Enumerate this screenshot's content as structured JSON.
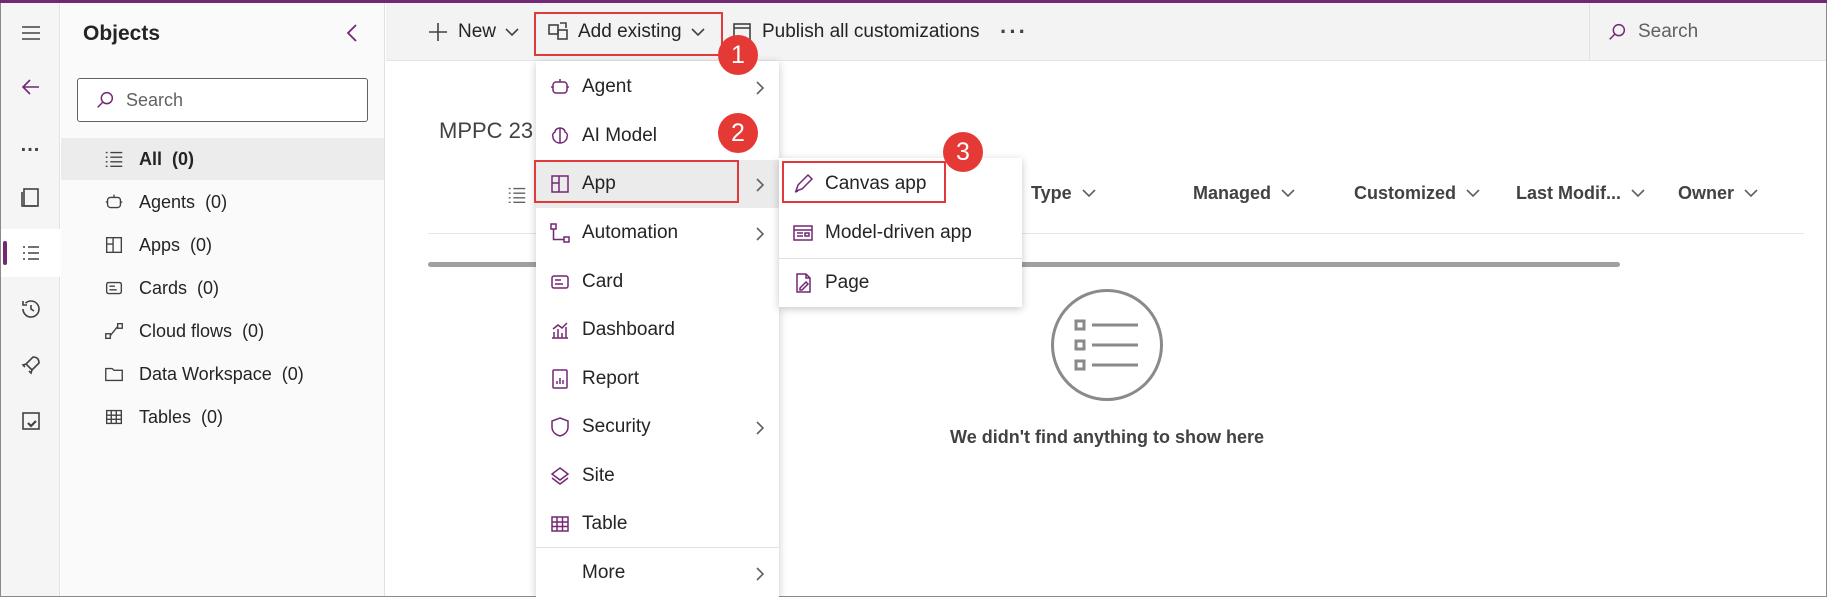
{
  "rail": {
    "items": [
      {
        "name": "menu-icon"
      },
      {
        "name": "back-arrow-icon"
      },
      {
        "name": "more-icon",
        "label": "..."
      },
      {
        "name": "pages-icon"
      },
      {
        "name": "objects-icon"
      },
      {
        "name": "history-icon"
      },
      {
        "name": "rocket-icon"
      },
      {
        "name": "solution-checker-icon"
      }
    ]
  },
  "objects_panel": {
    "title": "Objects",
    "search_placeholder": "Search",
    "items": [
      {
        "label": "All",
        "count": "(0)",
        "icon": "list-icon"
      },
      {
        "label": "Agents",
        "count": "(0)",
        "icon": "bot-icon"
      },
      {
        "label": "Apps",
        "count": "(0)",
        "icon": "apps-icon"
      },
      {
        "label": "Cards",
        "count": "(0)",
        "icon": "card-icon"
      },
      {
        "label": "Cloud flows",
        "count": "(0)",
        "icon": "flow-icon"
      },
      {
        "label": "Data Workspace",
        "count": "(0)",
        "icon": "folder-icon"
      },
      {
        "label": "Tables",
        "count": "(0)",
        "icon": "table-icon"
      }
    ]
  },
  "command_bar": {
    "new_label": "New",
    "add_existing_label": "Add existing",
    "publish_label": "Publish all customizations",
    "more_label": "···",
    "search_placeholder": "Search"
  },
  "main": {
    "solution_name": "MPPC 23",
    "columns": [
      {
        "label": "Type"
      },
      {
        "label": "Managed"
      },
      {
        "label": "Customized"
      },
      {
        "label": "Last Modif..."
      },
      {
        "label": "Owner"
      }
    ],
    "empty_message": "We didn't find anything to show here"
  },
  "add_existing_menu": {
    "items": [
      {
        "label": "Agent",
        "icon": "bot-icon",
        "submenu": true
      },
      {
        "label": "AI Model",
        "icon": "brain-icon",
        "submenu": false
      },
      {
        "label": "App",
        "icon": "apps-icon",
        "submenu": true
      },
      {
        "label": "Automation",
        "icon": "flow-icon",
        "submenu": true
      },
      {
        "label": "Card",
        "icon": "card-icon",
        "submenu": false
      },
      {
        "label": "Dashboard",
        "icon": "dashboard-icon",
        "submenu": false
      },
      {
        "label": "Report",
        "icon": "report-icon",
        "submenu": false
      },
      {
        "label": "Security",
        "icon": "shield-icon",
        "submenu": true
      },
      {
        "label": "Site",
        "icon": "site-icon",
        "submenu": false
      },
      {
        "label": "Table",
        "icon": "table-icon",
        "submenu": false
      },
      {
        "label": "More",
        "icon": "",
        "submenu": true
      }
    ]
  },
  "app_submenu": {
    "items": [
      {
        "label": "Canvas app",
        "icon": "pencil-icon"
      },
      {
        "label": "Model-driven app",
        "icon": "model-app-icon"
      },
      {
        "label": "Page",
        "icon": "page-icon"
      }
    ]
  },
  "callouts": [
    {
      "number": "1"
    },
    {
      "number": "2"
    },
    {
      "number": "3"
    }
  ],
  "colors": {
    "accent": "#742774",
    "highlight": "#e03b3b",
    "badge": "#e53935"
  }
}
